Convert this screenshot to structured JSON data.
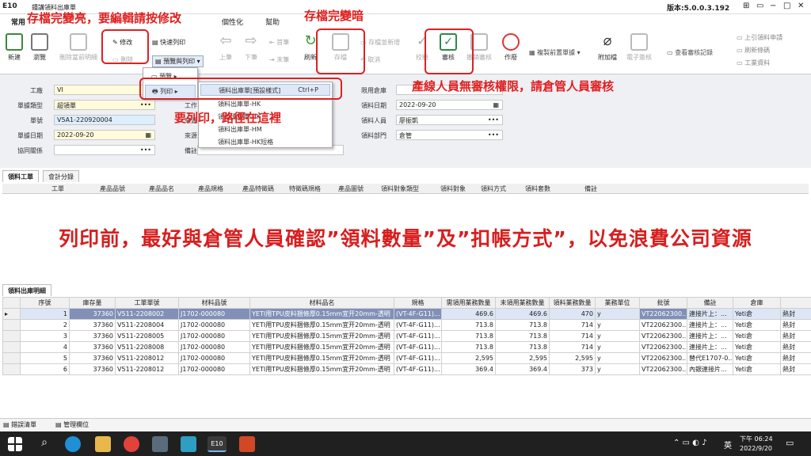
{
  "window": {
    "app_badge": "E10",
    "title": "鍾講領料出庫單",
    "version": "版本:5.0.0.3.192",
    "controls": [
      "⊞",
      "▭",
      "−",
      "□",
      "✕"
    ]
  },
  "ribbon_tabs": [
    "常用",
    "個性化",
    "幫助"
  ],
  "toolbar": {
    "new": "新建",
    "browse": "瀏覽",
    "delete_current_detail": "刪除當前明細",
    "edit": "修改",
    "delete": "刪除",
    "quick_print": "快速列印",
    "preview_print": "預覽與列印",
    "prev": "上筆",
    "next": "下筆",
    "first": "首筆",
    "last": "末筆",
    "refresh": "刷新",
    "save": "存檔",
    "save_and_new": "存檔並新增",
    "cancel": "取消",
    "verify": "校驗",
    "approve": "審核",
    "cancel_approve": "撤銷審核",
    "void": "作廢",
    "copy_prev": "複製前置單據",
    "attachment": "附加檔",
    "esign": "電子簽核",
    "view_approval": "查看審核記錄",
    "upper_request": "上引領料申請",
    "refresh_barcode": "刷新條碼",
    "work_data": "工業資料"
  },
  "annotations": {
    "edit_note": "存檔完變亮，要編輯請按修改",
    "save_note": "存檔完變暗",
    "approve_note": "產線人員無審核權限，請倉管人員審核",
    "print_note": "要列印，路徑在這裡",
    "main_note": "列印前，最好與倉管人員確認”領料數量”及”扣帳方式”，以免浪費公司資源"
  },
  "preview_menu": {
    "preview": "預覽",
    "print": "列印"
  },
  "print_submenu": [
    {
      "label": "領料出庫單[預設樣式]",
      "shortcut": "Ctrl+P"
    },
    {
      "label": "領料出庫單-HK",
      "shortcut": ""
    },
    {
      "label": "領料出庫單-HK",
      "shortcut": ""
    },
    {
      "label": "領料出庫單-HM",
      "shortcut": ""
    },
    {
      "label": "領料出庫單-HK短格",
      "shortcut": ""
    }
  ],
  "form": {
    "factory_label": "工廠",
    "factory_value": "VI",
    "doctype_label": "單據類型",
    "doctype_value": "超領單",
    "docno_label": "單號",
    "docno_value": "V5A1-220920004",
    "docdate_label": "單據日期",
    "docdate_value": "2022-09-20",
    "relation_label": "協同關係",
    "relation_value": "",
    "col2_label_a": "工作",
    "col2_label_b": "來源",
    "col2_label_c": "來源",
    "col2_label_d": "備註",
    "warehouse_label": "限用倉庫",
    "warehouse_value": "",
    "issuedate_label": "領料日期",
    "issuedate_value": "2022-09-20",
    "person_label": "領料人員",
    "person_value": "廖振凱",
    "dept_label": "領料部門",
    "dept_value": "倉管"
  },
  "upper_tabs": [
    "領料工單",
    "會計分錄"
  ],
  "upper_columns": [
    "工單",
    "產品品號",
    "產品品名",
    "產品規格",
    "產品特徵碼",
    "特徵碼規格",
    "產品圖號",
    "領料對象類型",
    "領料對象",
    "領料方式",
    "領料套數",
    "備註"
  ],
  "lower_tab": "領料出庫明細",
  "detail_columns": [
    "序號",
    "庫存量",
    "工單單號",
    "材料品號",
    "材料品名",
    "規格",
    "需領用業務數量",
    "未領用業務數量",
    "領料業務數量",
    "業務單位",
    "批號",
    "備註",
    "倉庫"
  ],
  "detail_rows": [
    {
      "seq": "1",
      "stock": "37360",
      "wo": "V511-2208002",
      "item": "J1702-000080",
      "name": "YETI用TPU皮料捆條厚0.15mm宜开20mm-透明",
      "spec": "(VT-4F-G11)...",
      "need": "469.6",
      "remain": "469.6",
      "qty": "470",
      "unit": "y",
      "lot": "VT22062300...",
      "note": "連接片上：...",
      "wh": "Yeti倉",
      "extra": "熱封"
    },
    {
      "seq": "2",
      "stock": "37360",
      "wo": "V511-2208004",
      "item": "J1702-000080",
      "name": "YETI用TPU皮料捆條厚0.15mm宜开20mm-透明",
      "spec": "(VT-4F-G11)...",
      "need": "713.8",
      "remain": "713.8",
      "qty": "714",
      "unit": "y",
      "lot": "VT22062300...",
      "note": "連接片上：...",
      "wh": "Yeti倉",
      "extra": "熱封"
    },
    {
      "seq": "3",
      "stock": "37360",
      "wo": "V511-2208005",
      "item": "J1702-000080",
      "name": "YETI用TPU皮料捆條厚0.15mm宜开20mm-透明",
      "spec": "(VT-4F-G11)...",
      "need": "713.8",
      "remain": "713.8",
      "qty": "714",
      "unit": "y",
      "lot": "VT22062300...",
      "note": "連接片上：...",
      "wh": "Yeti倉",
      "extra": "熱封"
    },
    {
      "seq": "4",
      "stock": "37360",
      "wo": "V511-2208008",
      "item": "J1702-000080",
      "name": "YETI用TPU皮料捆條厚0.15mm宜开20mm-透明",
      "spec": "(VT-4F-G11)...",
      "need": "713.8",
      "remain": "713.8",
      "qty": "714",
      "unit": "y",
      "lot": "VT22062300...",
      "note": "連接片上：...",
      "wh": "Yeti倉",
      "extra": "熱封"
    },
    {
      "seq": "5",
      "stock": "37360",
      "wo": "V511-2208012",
      "item": "J1702-000080",
      "name": "YETI用TPU皮料捆條厚0.15mm宜开20mm-透明",
      "spec": "(VT-4F-G11)...",
      "need": "2,595",
      "remain": "2,595",
      "qty": "2,595",
      "unit": "y",
      "lot": "VT22062300...",
      "note": "替代E1707-0...",
      "wh": "Yeti倉",
      "extra": "熱封"
    },
    {
      "seq": "6",
      "stock": "37360",
      "wo": "V511-2208012",
      "item": "J1702-000080",
      "name": "YETI用TPU皮料捆條厚0.15mm宜开20mm-透明",
      "spec": "(VT-4F-G11)...",
      "need": "369.4",
      "remain": "369.4",
      "qty": "373",
      "unit": "y",
      "lot": "VT22062300...",
      "note": "內銀連接片...",
      "wh": "Yeti倉",
      "extra": "熱封"
    }
  ],
  "bottom_tabs": [
    "錯誤清單",
    "管理欄位"
  ],
  "taskbar": {
    "ime": "英",
    "time": "下午 06:24",
    "date": "2022/9/20",
    "app_label": "E10"
  },
  "colors": {
    "annotation": "#e02020",
    "selected_row": "#8090b8",
    "main_note": "#d81e1e",
    "taskbar": "#202020"
  }
}
